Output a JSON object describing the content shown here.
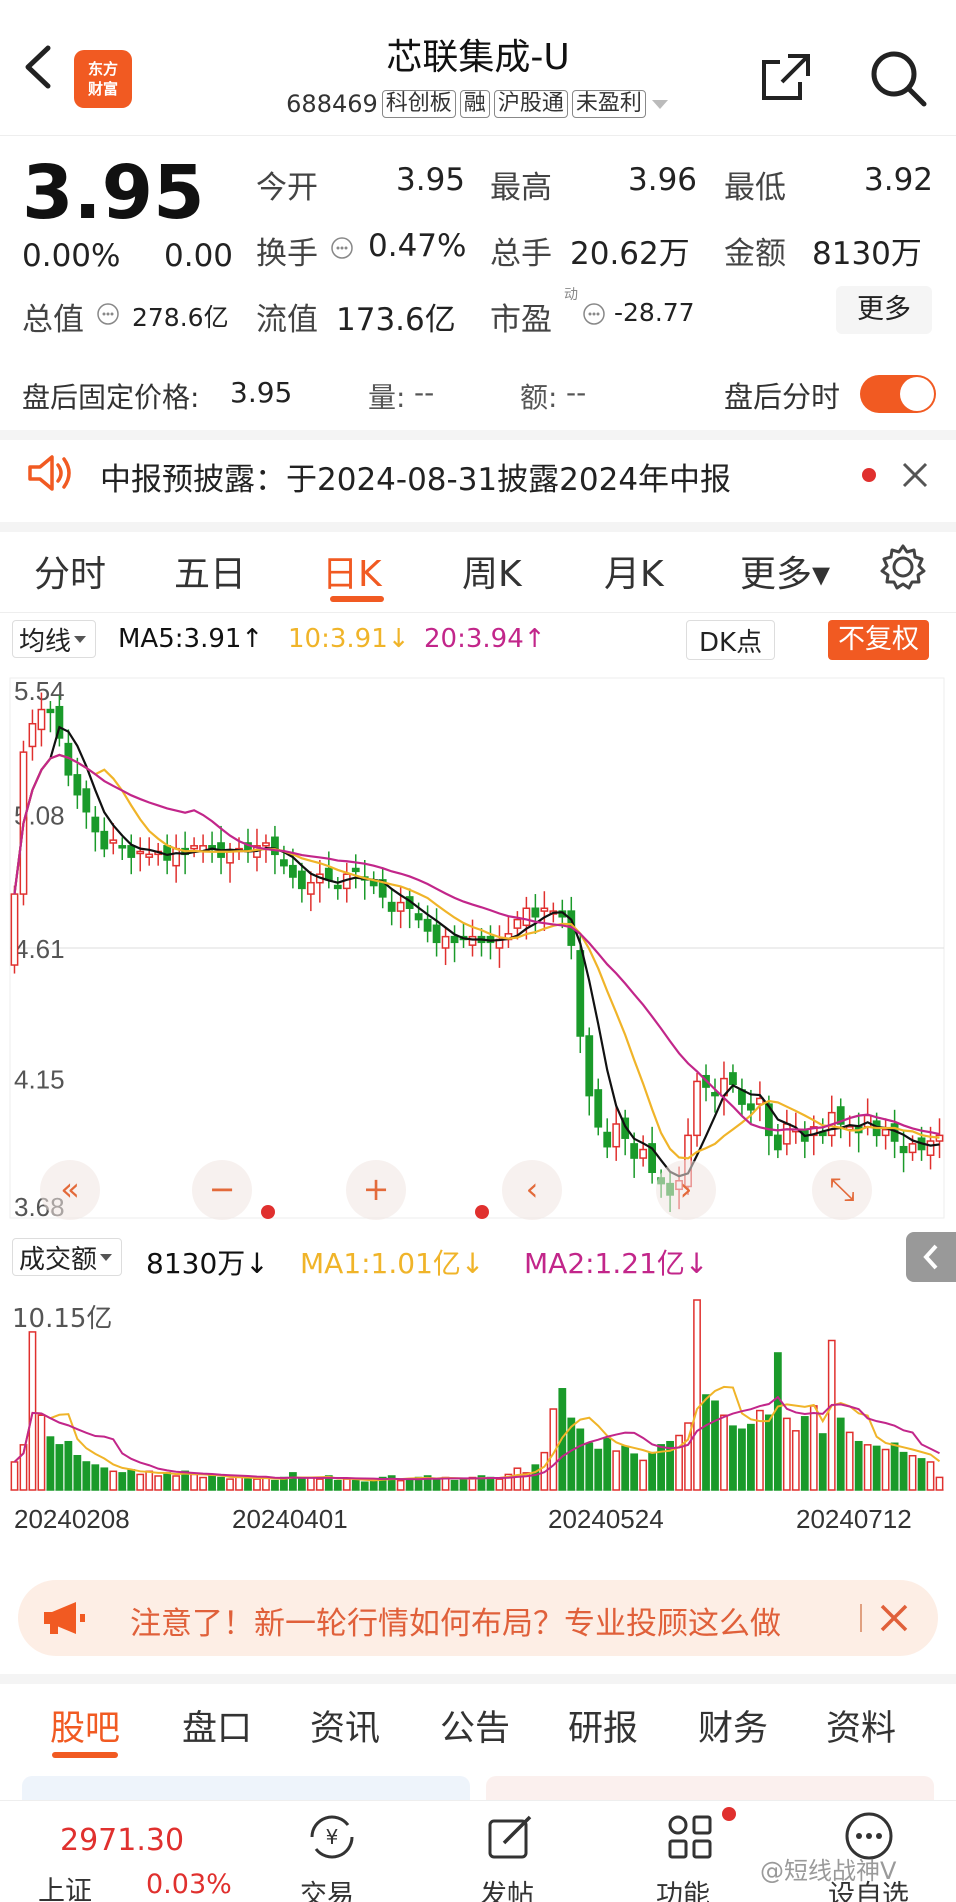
{
  "header": {
    "logo_line1": "东方",
    "logo_line2": "财富",
    "title": "芯联集成-U",
    "code": "688469",
    "tags": [
      "科创板",
      "融",
      "沪股通",
      "未盈利"
    ]
  },
  "quote": {
    "price": "3.95",
    "change_pct": "0.00%",
    "change": "0.00",
    "open_label": "今开",
    "open": "3.95",
    "high_label": "最高",
    "high": "3.96",
    "low_label": "最低",
    "low": "3.92",
    "turnover_label": "换手",
    "turnover": "0.47%",
    "volume_label": "总手",
    "volume": "20.62万",
    "amount_label": "金额",
    "amount": "8130万",
    "mcap_label": "总值",
    "mcap": "278.6亿",
    "float_label": "流值",
    "float": "173.6亿",
    "pe_label": "市盈",
    "pe_sup": "动",
    "pe": "-28.77",
    "more": "更多"
  },
  "after_hours": {
    "label": "盘后固定价格:",
    "price": "3.95",
    "vol_label": "量:",
    "vol": "--",
    "amt_label": "额:",
    "amt": "--",
    "toggle_label": "盘后分时",
    "toggle_on": true
  },
  "notice": {
    "text": "中报预披露：于2024-08-31披露2024年中报"
  },
  "chart_tabs": [
    "分时",
    "五日",
    "日K",
    "周K",
    "月K",
    "更多▾"
  ],
  "active_chart_tab": "日K",
  "ma_bar": {
    "selector": "均线",
    "ma5": "MA5:3.91↑",
    "ma10": "10:3.91↓",
    "ma20": "20:3.94↑",
    "dk": "DK点",
    "fuquan": "不复权"
  },
  "vol_bar": {
    "selector": "成交额",
    "value": "8130万↓",
    "ma1": "MA1:1.01亿↓",
    "ma2": "MA2:1.21亿↓",
    "max_label": "10.15亿"
  },
  "colors": {
    "up": "#e0302e",
    "down": "#1a9a2a",
    "accent": "#f15a22",
    "ma5": "#111111",
    "ma10": "#f0b429",
    "ma20": "#c2268a"
  },
  "chart_data": {
    "type": "candlestick",
    "ylim": [
      3.68,
      5.54
    ],
    "y_ticks": [
      "5.54",
      "5.08",
      "4.61",
      "4.15",
      "3.68"
    ],
    "x_ticks": [
      "20240208",
      "20240401",
      "20240524",
      "20240712"
    ],
    "close": [
      4.8,
      5.3,
      5.4,
      5.45,
      5.44,
      5.35,
      5.22,
      5.15,
      5.09,
      5.02,
      4.96,
      4.99,
      4.97,
      4.93,
      4.95,
      4.94,
      4.95,
      4.92,
      4.96,
      4.94,
      4.97,
      4.97,
      4.96,
      4.93,
      4.95,
      4.96,
      4.95,
      4.97,
      4.98,
      4.94,
      4.9,
      4.86,
      4.82,
      4.84,
      4.87,
      4.85,
      4.82,
      4.87,
      4.88,
      4.85,
      4.83,
      4.79,
      4.74,
      4.77,
      4.75,
      4.71,
      4.67,
      4.63,
      4.65,
      4.63,
      4.64,
      4.65,
      4.63,
      4.63,
      4.64,
      4.66,
      4.71,
      4.75,
      4.72,
      4.75,
      4.74,
      4.72,
      4.62,
      4.3,
      4.09,
      3.98,
      3.91,
      3.99,
      3.94,
      3.87,
      3.9,
      3.82,
      3.78,
      3.74,
      3.79,
      3.95,
      4.14,
      4.12,
      4.09,
      4.15,
      4.13,
      4.06,
      4.04,
      4.08,
      3.95,
      3.9,
      3.99,
      3.97,
      3.93,
      3.98,
      3.95,
      4.03,
      3.99,
      3.98,
      3.96,
      4.02,
      3.95,
      3.97,
      3.93,
      3.89,
      3.92,
      3.9,
      3.93,
      3.95
    ],
    "ma5_label": "MA5",
    "ma10_label": "MA10",
    "ma20_label": "MA20",
    "volume": [
      1.8,
      2.9,
      10.15,
      4.8,
      3.4,
      2.9,
      3.1,
      2.2,
      1.8,
      1.6,
      1.4,
      1.2,
      1.1,
      1.3,
      1.0,
      1.2,
      0.9,
      1.1,
      0.9,
      1.2,
      1.0,
      0.8,
      0.9,
      0.8,
      0.7,
      0.9,
      0.7,
      0.7,
      0.8,
      0.6,
      0.8,
      1.1,
      0.7,
      0.8,
      0.7,
      0.9,
      0.6,
      0.7,
      0.6,
      0.5,
      0.7,
      0.8,
      0.9,
      0.6,
      0.7,
      0.8,
      0.9,
      0.7,
      0.8,
      0.6,
      0.7,
      0.8,
      0.9,
      0.8,
      0.7,
      1.0,
      1.4,
      1.1,
      1.6,
      2.4,
      5.2,
      6.5,
      4.6,
      3.9,
      3.0,
      2.6,
      3.3,
      2.5,
      2.8,
      2.3,
      1.9,
      2.4,
      2.9,
      3.1,
      3.5,
      4.3,
      12.2,
      6.1,
      5.7,
      4.8,
      4.1,
      3.9,
      4.2,
      5.1,
      4.8,
      8.8,
      4.6,
      3.8,
      4.7,
      5.4,
      3.6,
      9.6,
      4.6,
      3.7,
      3.1,
      2.9,
      2.8,
      2.6,
      3.0,
      2.4,
      2.2,
      2.0,
      1.8,
      0.81
    ]
  },
  "ad": {
    "text": "注意了！新一轮行情如何布局？专业投顾这么做"
  },
  "bottom_tabs": [
    "股吧",
    "盘口",
    "资讯",
    "公告",
    "研报",
    "财务",
    "资料"
  ],
  "active_bottom_tab": "股吧",
  "footer": {
    "index_value": "2971.30",
    "index_name": "上证",
    "index_change": "0.03%",
    "items": [
      "交易",
      "发帖",
      "功能",
      "设自选"
    ],
    "watermark": "@短线战神V"
  }
}
